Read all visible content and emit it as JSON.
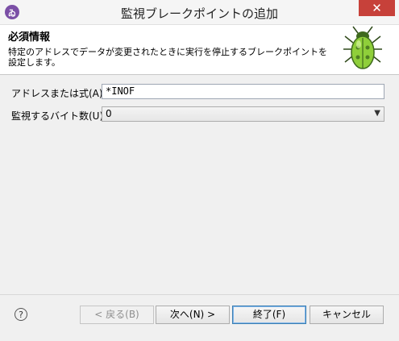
{
  "window": {
    "title": "監視ブレークポイントの追加",
    "close_label": "✕",
    "app_icon_label": "ゐ"
  },
  "header": {
    "title": "必須情報",
    "description": "特定のアドレスでデータが変更されたときに実行を停止するブレークポイントを設定します。"
  },
  "form": {
    "address_label": "アドレスまたは式(A):",
    "address_value": "*INOF",
    "bytes_label": "監視するバイト数(U):",
    "bytes_value": "0"
  },
  "footer": {
    "help_label": "?",
    "back_label": "< 戻る(B)",
    "next_label": "次へ(N) >",
    "finish_label": "終了(F)",
    "cancel_label": "キャンセル"
  },
  "colors": {
    "close": "#c7413a",
    "default_button_border": "#3c7fb1"
  }
}
